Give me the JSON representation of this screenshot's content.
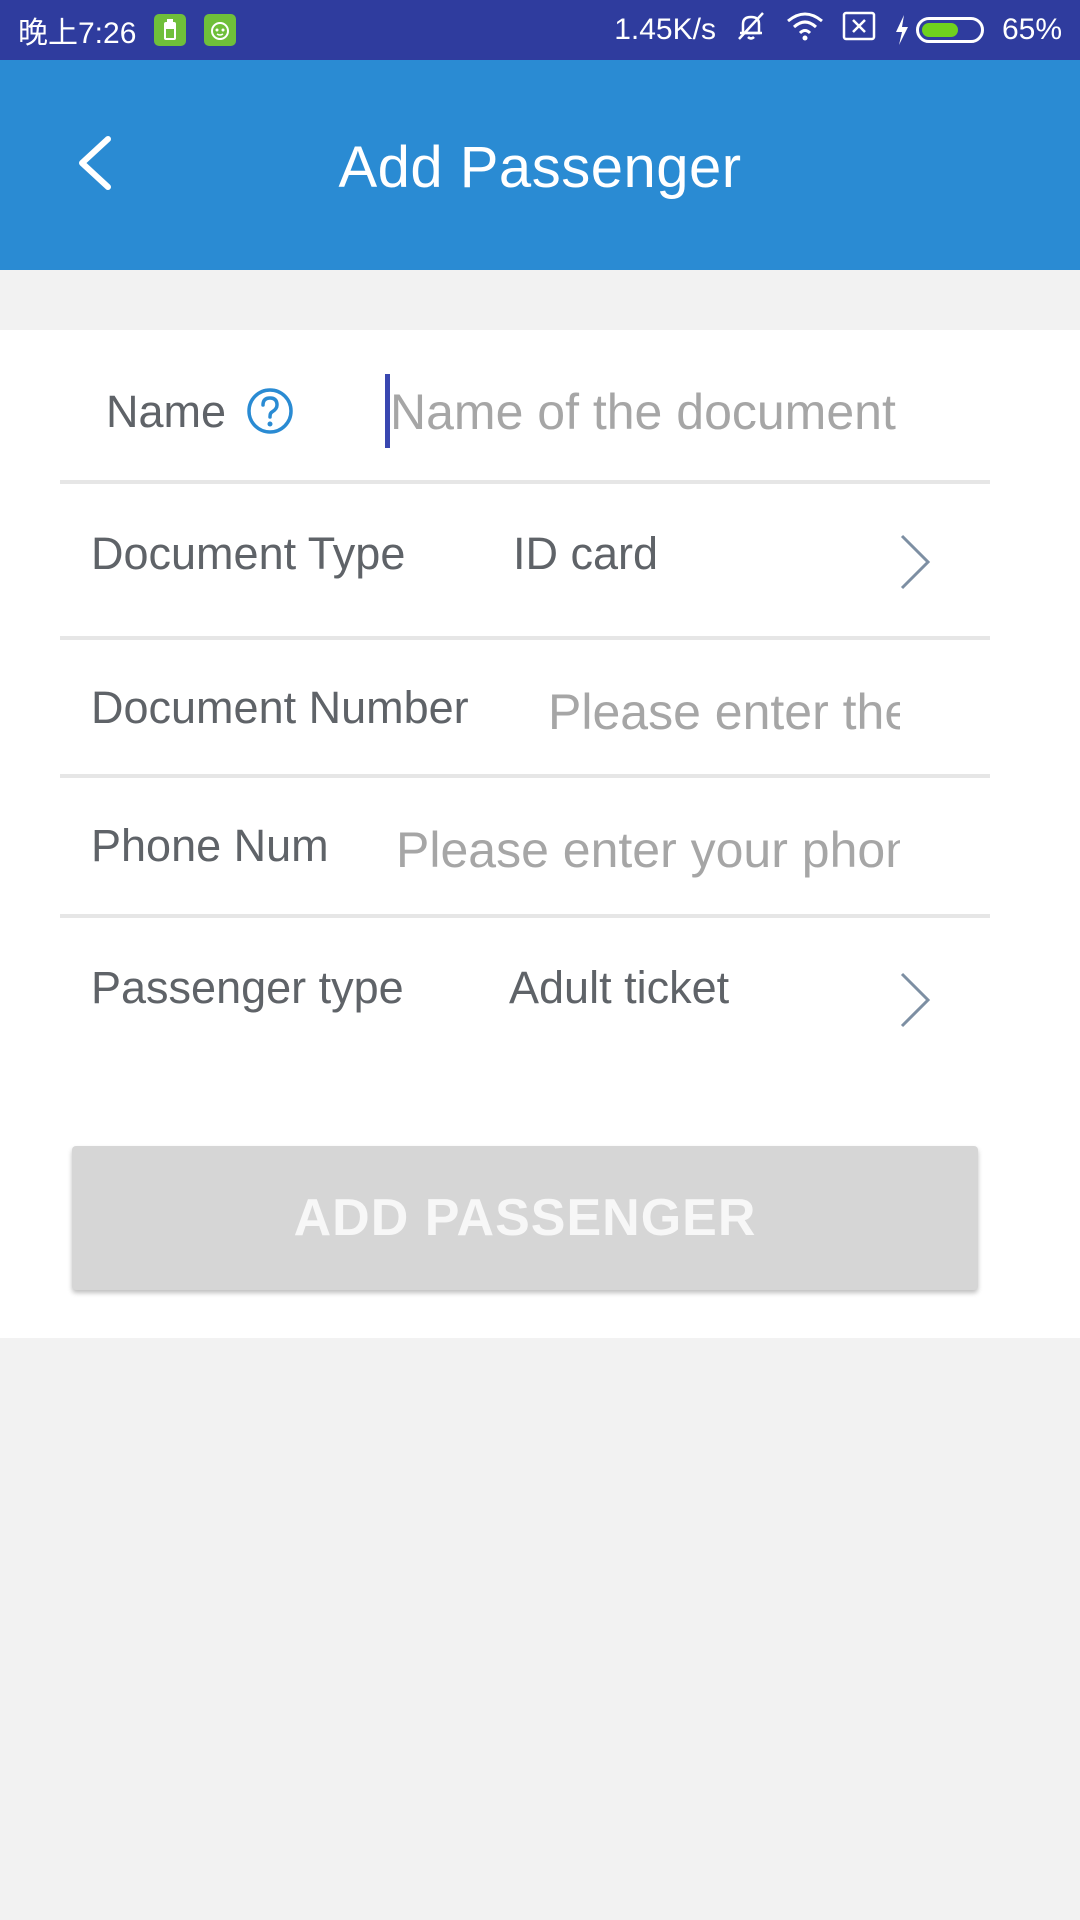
{
  "status_bar": {
    "time": "晚上7:26",
    "network_speed": "1.45K/s",
    "battery_percent": "65%",
    "battery_level": 0.65,
    "icons": [
      "battery-app-icon",
      "android-app-icon",
      "mute-icon",
      "wifi-icon",
      "no-sim-icon",
      "charging-icon",
      "battery-icon"
    ]
  },
  "app_bar": {
    "title": "Add Passenger",
    "back_icon": "chevron-left-icon"
  },
  "form": {
    "name": {
      "label": "Name",
      "help_icon": "question-circle-icon",
      "placeholder": "Name of the document",
      "value": ""
    },
    "document_type": {
      "label": "Document Type",
      "value": "ID card",
      "icon": "chevron-right-icon"
    },
    "document_number": {
      "label": "Document Number",
      "placeholder": "Please enter the document number",
      "value": ""
    },
    "phone": {
      "label": "Phone Num",
      "placeholder": "Please enter your phone number",
      "value": ""
    },
    "passenger_type": {
      "label": "Passenger type",
      "value": "Adult ticket",
      "icon": "chevron-right-icon"
    }
  },
  "actions": {
    "add_label": "ADD PASSENGER"
  },
  "colors": {
    "status_bar": "#2f3c9e",
    "app_bar": "#2a8bd3",
    "accent": "#2a8bd3",
    "button_disabled": "#d6d6d6",
    "page_bg": "#f2f2f2"
  }
}
